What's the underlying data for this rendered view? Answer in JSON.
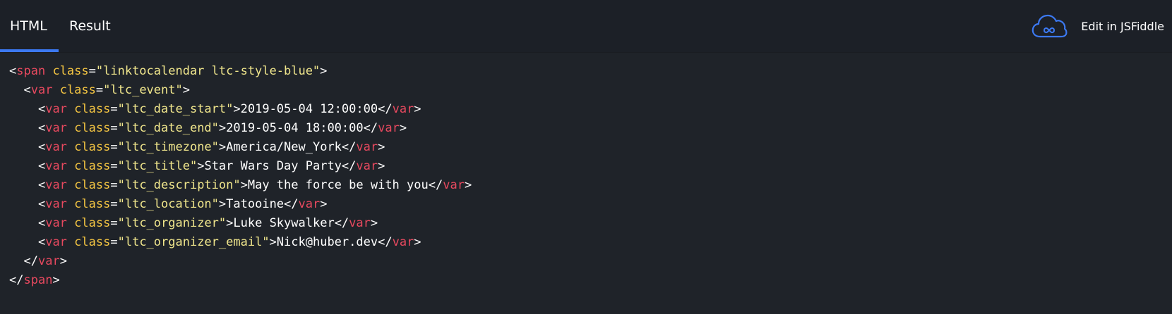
{
  "tabs": {
    "html_label": "HTML",
    "result_label": "Result"
  },
  "jsfiddle": {
    "label": "Edit in JSFiddle",
    "icon": "cloud-infinity-icon"
  },
  "colors": {
    "background": "#1f2329",
    "topbar": "#1c2027",
    "active_tab_underline": "#3c79f2",
    "tag": "#e8495f",
    "attribute": "#f4c542",
    "string": "#f0e68c",
    "text": "#ffffff"
  },
  "code": {
    "lines": [
      {
        "indent": "",
        "open": "<",
        "tag": "span",
        "attr": "class",
        "eq": "=",
        "value": "\"linktocalendar ltc-style-blue\"",
        "close": ">",
        "content": "",
        "end_open": "",
        "end_tag": "",
        "end_close": ""
      },
      {
        "indent": "  ",
        "open": "<",
        "tag": "var",
        "attr": "class",
        "eq": "=",
        "value": "\"ltc_event\"",
        "close": ">",
        "content": "",
        "end_open": "",
        "end_tag": "",
        "end_close": ""
      },
      {
        "indent": "    ",
        "open": "<",
        "tag": "var",
        "attr": "class",
        "eq": "=",
        "value": "\"ltc_date_start\"",
        "close": ">",
        "content": "2019-05-04 12:00:00",
        "end_open": "</",
        "end_tag": "var",
        "end_close": ">"
      },
      {
        "indent": "    ",
        "open": "<",
        "tag": "var",
        "attr": "class",
        "eq": "=",
        "value": "\"ltc_date_end\"",
        "close": ">",
        "content": "2019-05-04 18:00:00",
        "end_open": "</",
        "end_tag": "var",
        "end_close": ">"
      },
      {
        "indent": "    ",
        "open": "<",
        "tag": "var",
        "attr": "class",
        "eq": "=",
        "value": "\"ltc_timezone\"",
        "close": ">",
        "content": "America/New_York",
        "end_open": "</",
        "end_tag": "var",
        "end_close": ">"
      },
      {
        "indent": "    ",
        "open": "<",
        "tag": "var",
        "attr": "class",
        "eq": "=",
        "value": "\"ltc_title\"",
        "close": ">",
        "content": "Star Wars Day Party",
        "end_open": "</",
        "end_tag": "var",
        "end_close": ">"
      },
      {
        "indent": "    ",
        "open": "<",
        "tag": "var",
        "attr": "class",
        "eq": "=",
        "value": "\"ltc_description\"",
        "close": ">",
        "content": "May the force be with you",
        "end_open": "</",
        "end_tag": "var",
        "end_close": ">"
      },
      {
        "indent": "    ",
        "open": "<",
        "tag": "var",
        "attr": "class",
        "eq": "=",
        "value": "\"ltc_location\"",
        "close": ">",
        "content": "Tatooine",
        "end_open": "</",
        "end_tag": "var",
        "end_close": ">"
      },
      {
        "indent": "    ",
        "open": "<",
        "tag": "var",
        "attr": "class",
        "eq": "=",
        "value": "\"ltc_organizer\"",
        "close": ">",
        "content": "Luke Skywalker",
        "end_open": "</",
        "end_tag": "var",
        "end_close": ">"
      },
      {
        "indent": "    ",
        "open": "<",
        "tag": "var",
        "attr": "class",
        "eq": "=",
        "value": "\"ltc_organizer_email\"",
        "close": ">",
        "content": "Nick@huber.dev",
        "end_open": "</",
        "end_tag": "var",
        "end_close": ">"
      },
      {
        "indent": "  ",
        "open": "",
        "tag": "",
        "attr": "",
        "eq": "",
        "value": "",
        "close": "",
        "content": "",
        "end_open": "</",
        "end_tag": "var",
        "end_close": ">"
      },
      {
        "indent": "",
        "open": "",
        "tag": "",
        "attr": "",
        "eq": "",
        "value": "",
        "close": "",
        "content": "",
        "end_open": "</",
        "end_tag": "span",
        "end_close": ">"
      }
    ]
  }
}
